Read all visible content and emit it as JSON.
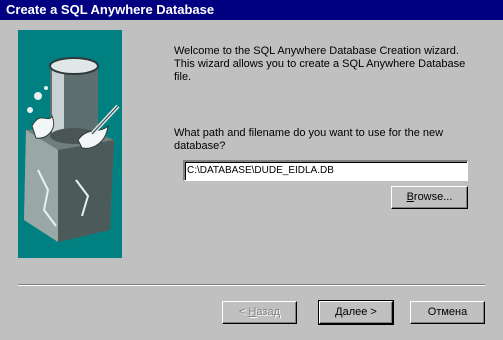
{
  "window": {
    "title": "Create a SQL Anywhere Database"
  },
  "wizard": {
    "welcome_text": "Welcome to the SQL Anywhere Database Creation wizard. This wizard allows you to create a SQL Anywhere Database file.",
    "question_text": "What path and filename do you want to use for the new database?",
    "path_value": "C:\\DATABASE\\DUDE_EIDLA.DB"
  },
  "buttons": {
    "browse_first": "B",
    "browse_rest": "rowse...",
    "back_prefix": "< ",
    "back_hotkey": "Н",
    "back_rest": "азад",
    "next_hotkey": "Д",
    "next_rest": "алее >",
    "cancel_label": "Отмена"
  },
  "colors": {
    "titlebar": "#000080",
    "art_background": "#008080",
    "face": "#c0c0c0"
  }
}
